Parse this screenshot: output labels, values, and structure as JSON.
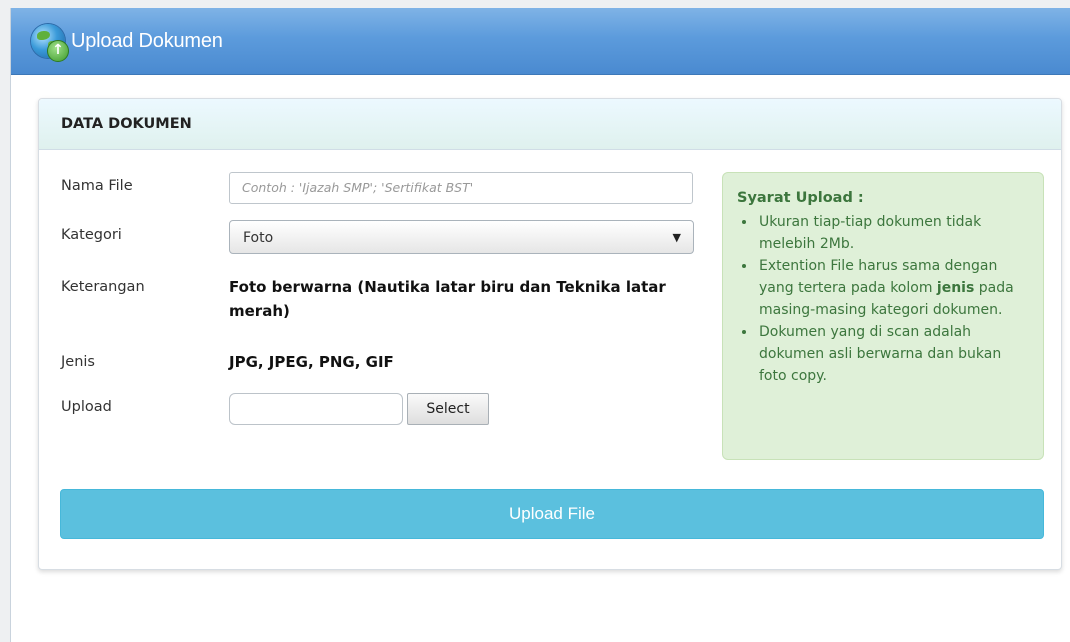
{
  "header": {
    "title": "Upload Dokumen"
  },
  "panel": {
    "heading": "DATA DOKUMEN"
  },
  "form": {
    "nama_file_label": "Nama File",
    "nama_file_placeholder": "Contoh : 'Ijazah SMP'; 'Sertifikat BST'",
    "kategori_label": "Kategori",
    "kategori_value": "Foto",
    "keterangan_label": "Keterangan",
    "keterangan_value": "Foto berwarna (Nautika latar biru dan Teknika latar merah)",
    "jenis_label": "Jenis",
    "jenis_value": "JPG, JPEG, PNG, GIF",
    "upload_label": "Upload",
    "select_button": "Select",
    "submit_button": "Upload File"
  },
  "requirements": {
    "title": "Syarat Upload",
    "title_suffix": " :",
    "items": [
      "Ukuran tiap-tiap dokumen tidak melebih 2Mb.",
      {
        "before": "Extention File harus sama dengan yang tertera pada kolom ",
        "bold": "jenis",
        "after": " pada masing-masing kategori dokumen."
      },
      "Dokumen yang di scan adalah dokumen asli berwarna dan bukan foto copy."
    ]
  },
  "colors": {
    "header": "#5c9bdc",
    "info_bg": "#dff0d8",
    "info_text": "#3c763d",
    "submit_bg": "#5bc0de"
  }
}
